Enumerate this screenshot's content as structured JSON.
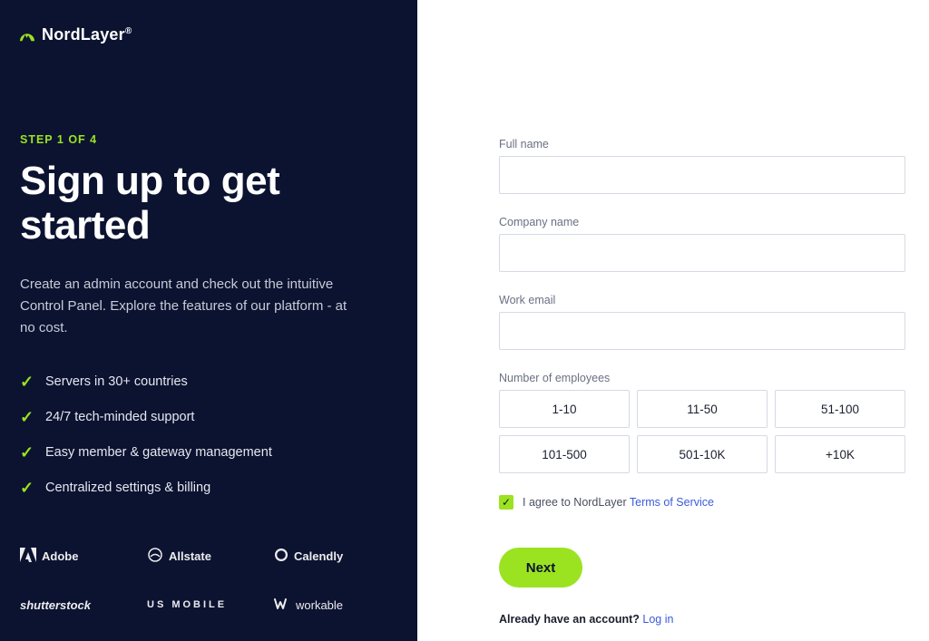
{
  "brand": {
    "name": "NordLayer",
    "trademark": "®"
  },
  "left": {
    "step_label": "STEP 1 OF 4",
    "headline": "Sign up to get started",
    "subtext": "Create an admin account and check out the intuitive Control Panel. Explore the features of our platform - at no cost.",
    "features": [
      "Servers in 30+ countries",
      "24/7 tech-minded support",
      "Easy member & gateway management",
      "Centralized settings & billing"
    ],
    "brands": [
      "Adobe",
      "Allstate",
      "Calendly",
      "shutterstock",
      "US MOBILE",
      "workable"
    ]
  },
  "form": {
    "full_name": {
      "label": "Full name",
      "value": ""
    },
    "company_name": {
      "label": "Company name",
      "value": ""
    },
    "work_email": {
      "label": "Work email",
      "value": ""
    },
    "employees": {
      "label": "Number of employees",
      "options": [
        "1-10",
        "11-50",
        "51-100",
        "101-500",
        "501-10K",
        "+10K"
      ]
    },
    "terms": {
      "checked": true,
      "text": "I agree to NordLayer",
      "link_text": "Terms of Service"
    },
    "next_button": "Next",
    "already_text": "Already have an account?",
    "login_text": "Log in"
  },
  "colors": {
    "accent": "#9be321",
    "dark": "#0c1330",
    "link": "#3b5bdb"
  }
}
